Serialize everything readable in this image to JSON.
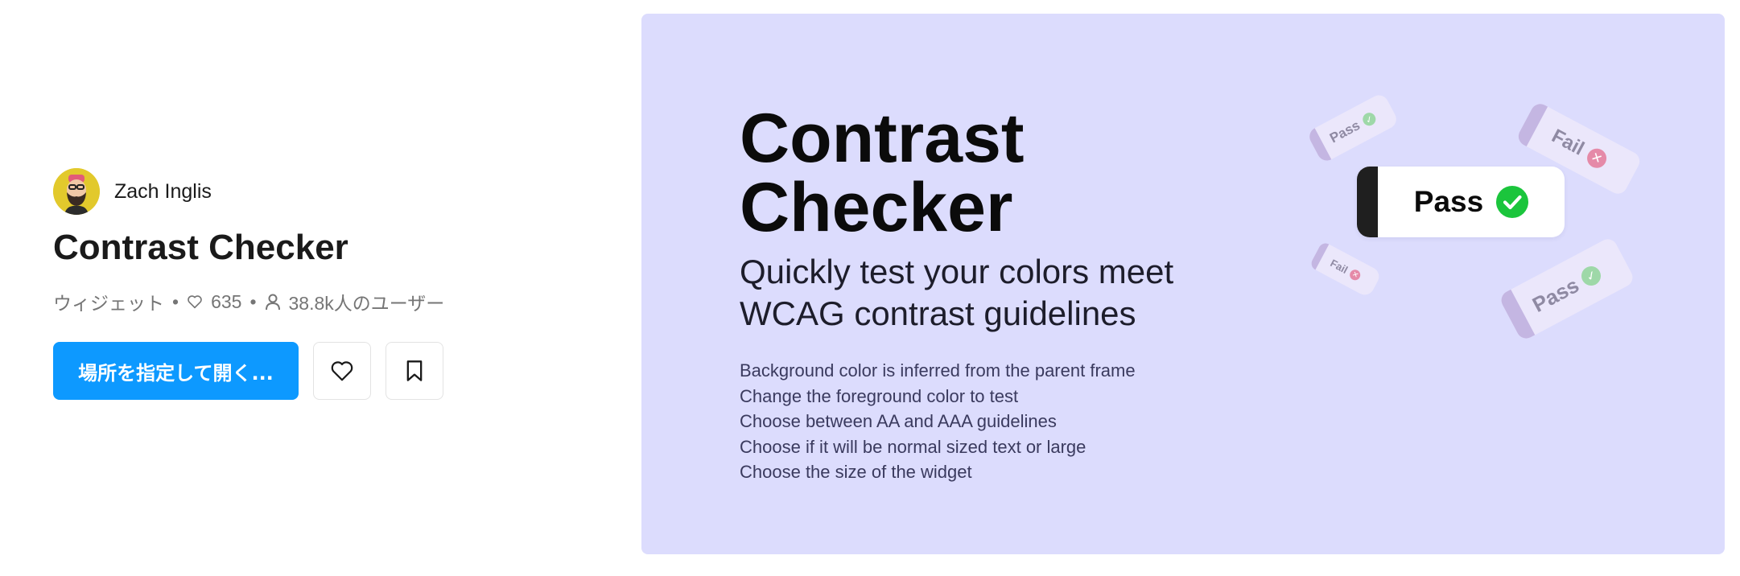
{
  "author": {
    "name": "Zach Inglis"
  },
  "plugin": {
    "title": "Contrast Checker"
  },
  "meta": {
    "type": "ウィジェット",
    "likes": "635",
    "users": "38.8k人のユーザー",
    "separator": "•"
  },
  "actions": {
    "open_label": "場所を指定して開く..."
  },
  "banner": {
    "title_line1": "Contrast",
    "title_line2": "Checker",
    "subtitle_line1": "Quickly test your colors meet",
    "subtitle_line2": "WCAG contrast guidelines",
    "features": [
      "Background color is inferred from the parent frame",
      "Change the foreground color to test",
      "Choose between AA and AAA guidelines",
      "Choose if it will be normal sized text or large",
      "Choose the size of the widget"
    ],
    "main_pill": "Pass",
    "chips": [
      "Pass",
      "Fail",
      "Fail",
      "Pass"
    ]
  },
  "colors": {
    "accent": "#0d99ff",
    "banner_bg": "#dcdcfd",
    "pass": "#1bc53c",
    "fail": "#e58aa8"
  }
}
